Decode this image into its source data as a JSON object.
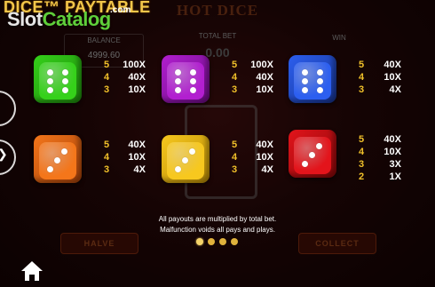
{
  "header": {
    "paytable_title": "DICE™ PAYTABLE",
    "watermark_part1": "Slot",
    "watermark_part2": "Catalog",
    "watermark_com": ".com"
  },
  "background": {
    "game_title": "HOT DICE",
    "balance_label": "BALANCE",
    "balance_value": "4999.60",
    "bet_label": "TOTAL BET",
    "bet_value": "0.00",
    "win_label": "WIN",
    "halve_label": "HALVE",
    "collect_label": "COLLECT"
  },
  "dice": [
    {
      "color": "green",
      "main": "#35d11a",
      "side": "#1e8a0c",
      "pips": 6,
      "pays": [
        {
          "count": "5",
          "value": "100X"
        },
        {
          "count": "4",
          "value": "40X"
        },
        {
          "count": "3",
          "value": "10X"
        }
      ]
    },
    {
      "color": "purple",
      "main": "#b21fd0",
      "side": "#6d0c86",
      "pips": 6,
      "pays": [
        {
          "count": "5",
          "value": "100X"
        },
        {
          "count": "4",
          "value": "40X"
        },
        {
          "count": "3",
          "value": "10X"
        }
      ]
    },
    {
      "color": "blue",
      "main": "#2c5ff0",
      "side": "#17338f",
      "pips": 6,
      "pays": [
        {
          "count": "5",
          "value": "40X"
        },
        {
          "count": "4",
          "value": "10X"
        },
        {
          "count": "3",
          "value": "4X"
        }
      ]
    },
    {
      "color": "orange",
      "main": "#f4761a",
      "side": "#a8420a",
      "pips": 3,
      "pays": [
        {
          "count": "5",
          "value": "40X"
        },
        {
          "count": "4",
          "value": "10X"
        },
        {
          "count": "3",
          "value": "4X"
        }
      ]
    },
    {
      "color": "yellow",
      "main": "#f7c81e",
      "side": "#b98c06",
      "pips": 3,
      "pays": [
        {
          "count": "5",
          "value": "40X"
        },
        {
          "count": "4",
          "value": "10X"
        },
        {
          "count": "3",
          "value": "4X"
        }
      ]
    },
    {
      "color": "red",
      "main": "#e3141b",
      "side": "#8a0709",
      "pips": 3,
      "pays": [
        {
          "count": "5",
          "value": "40X"
        },
        {
          "count": "4",
          "value": "10X"
        },
        {
          "count": "3",
          "value": "3X"
        },
        {
          "count": "2",
          "value": "1X"
        }
      ]
    }
  ],
  "footer": {
    "note_line1": "All payouts are multiplied by total bet.",
    "note_line2": "Malfunction voids all pays and plays.",
    "page_count": 4,
    "active_page": 1
  }
}
